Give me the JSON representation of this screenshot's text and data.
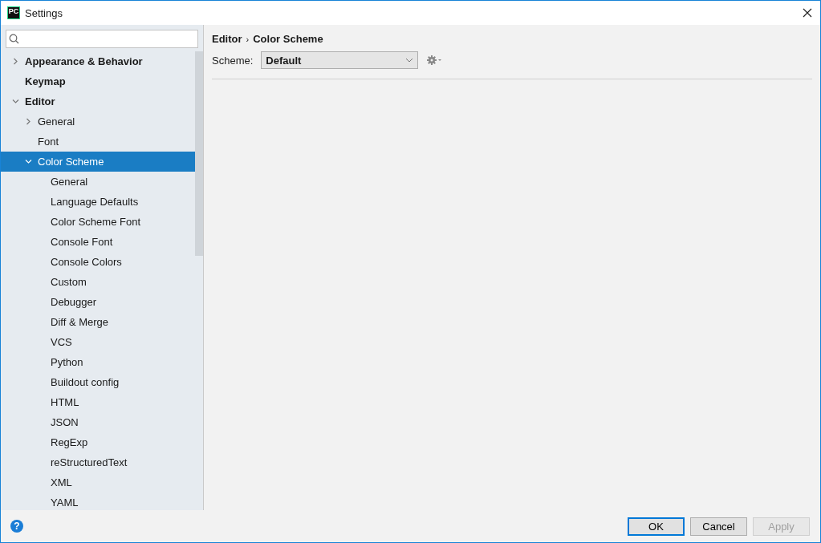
{
  "window": {
    "title": "Settings",
    "app_badge": "PC"
  },
  "tree": [
    {
      "label": "Appearance & Behavior",
      "expanded": false,
      "selected": false
    },
    {
      "label": "Keymap",
      "selected": false
    },
    {
      "label": "Editor",
      "expanded": true,
      "selected": false,
      "children": [
        {
          "label": "General",
          "expanded": false,
          "selected": false
        },
        {
          "label": "Font",
          "selected": false
        },
        {
          "label": "Color Scheme",
          "expanded": true,
          "selected": true,
          "children": [
            {
              "label": "General",
              "selected": false
            },
            {
              "label": "Language Defaults",
              "selected": false
            },
            {
              "label": "Color Scheme Font",
              "selected": false
            },
            {
              "label": "Console Font",
              "selected": false
            },
            {
              "label": "Console Colors",
              "selected": false
            },
            {
              "label": "Custom",
              "selected": false
            },
            {
              "label": "Debugger",
              "selected": false
            },
            {
              "label": "Diff & Merge",
              "selected": false
            },
            {
              "label": "VCS",
              "selected": false
            },
            {
              "label": "Python",
              "selected": false
            },
            {
              "label": "Buildout config",
              "selected": false
            },
            {
              "label": "HTML",
              "selected": false
            },
            {
              "label": "JSON",
              "selected": false
            },
            {
              "label": "RegExp",
              "selected": false
            },
            {
              "label": "reStructuredText",
              "selected": false
            },
            {
              "label": "XML",
              "selected": false
            },
            {
              "label": "YAML",
              "selected": false
            }
          ]
        }
      ]
    }
  ],
  "breadcrumb": [
    "Editor",
    "Color Scheme"
  ],
  "breadcrumb_separator": "›",
  "scheme": {
    "label": "Scheme:",
    "value": "Default"
  },
  "help": "?",
  "buttons": [
    {
      "label": "OK",
      "kind": "default",
      "disabled": false
    },
    {
      "label": "Cancel",
      "kind": "normal",
      "disabled": false
    },
    {
      "label": "Apply",
      "kind": "normal",
      "disabled": true
    }
  ]
}
